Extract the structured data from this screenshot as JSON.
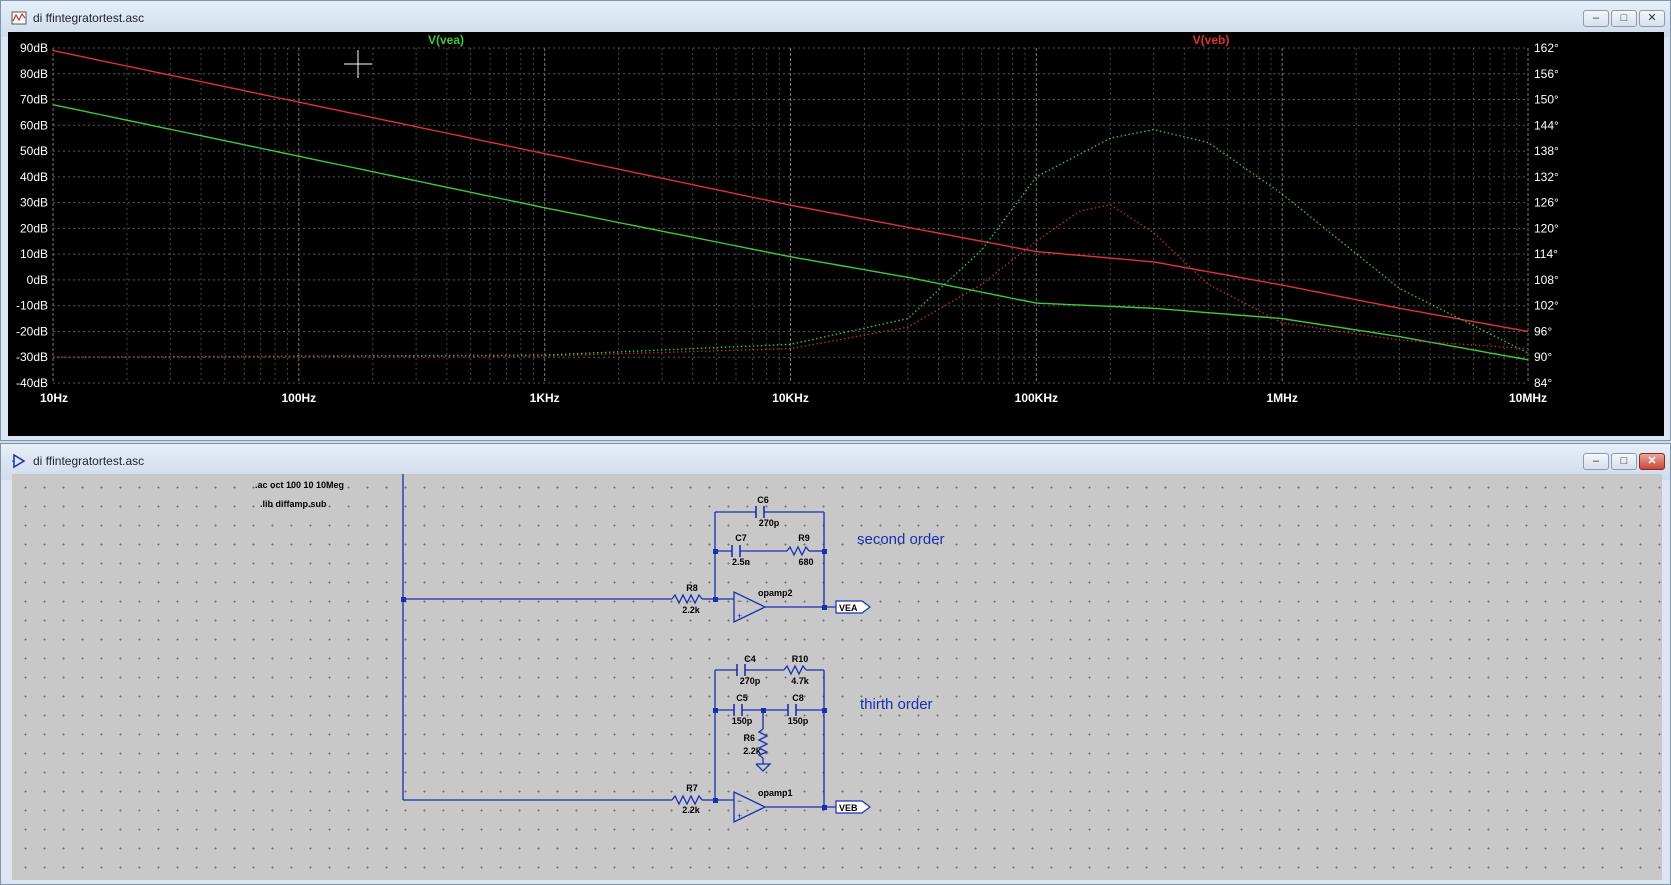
{
  "plot_window": {
    "title": "di ffintegratortest.asc",
    "controls": {
      "minimize": "–",
      "restore": "□",
      "close": "✕"
    }
  },
  "schematic_window": {
    "title": "di ffintegratortest.asc",
    "controls": {
      "minimize": "–",
      "restore": "□",
      "close": "✕"
    }
  },
  "chart_data": {
    "type": "line",
    "x_scale": "log",
    "xlim": [
      10,
      10000000
    ],
    "x_ticks": [
      {
        "value": 10,
        "label": "10Hz"
      },
      {
        "value": 100,
        "label": "100Hz"
      },
      {
        "value": 1000,
        "label": "1KHz"
      },
      {
        "value": 10000,
        "label": "10KHz"
      },
      {
        "value": 100000,
        "label": "100KHz"
      },
      {
        "value": 1000000,
        "label": "1MHz"
      },
      {
        "value": 10000000,
        "label": "10MHz"
      }
    ],
    "ylim": [
      -40,
      90
    ],
    "y_ticks": [
      "90dB",
      "80dB",
      "70dB",
      "60dB",
      "50dB",
      "40dB",
      "30dB",
      "20dB",
      "10dB",
      "0dB",
      "-10dB",
      "-20dB",
      "-30dB",
      "-40dB"
    ],
    "y2lim": [
      84,
      162
    ],
    "y2_ticks": [
      "162°",
      "156°",
      "150°",
      "144°",
      "138°",
      "132°",
      "126°",
      "120°",
      "114°",
      "108°",
      "102°",
      "96°",
      "90°",
      "84°"
    ],
    "grid": true,
    "legend": "top",
    "series": [
      {
        "name": "V(vea)",
        "color": "#3ec93e",
        "quantity": "magnitude",
        "points": [
          [
            10,
            68
          ],
          [
            100,
            48
          ],
          [
            1000,
            28
          ],
          [
            10000,
            9
          ],
          [
            30000,
            1
          ],
          [
            100000,
            -9
          ],
          [
            300000,
            -11
          ],
          [
            1000000,
            -15
          ],
          [
            3000000,
            -22
          ],
          [
            10000000,
            -31
          ]
        ]
      },
      {
        "name": "V(veb)",
        "color": "#e03232",
        "quantity": "magnitude",
        "points": [
          [
            10,
            89
          ],
          [
            100,
            69
          ],
          [
            1000,
            49
          ],
          [
            10000,
            29
          ],
          [
            100000,
            11
          ],
          [
            300000,
            7
          ],
          [
            1000000,
            -2
          ],
          [
            3000000,
            -11
          ],
          [
            10000000,
            -20
          ]
        ]
      },
      {
        "name": "V(vea)",
        "color": "#3ec93e",
        "quantity": "phase",
        "dotted": true,
        "points": [
          [
            10,
            90
          ],
          [
            1000,
            90.5
          ],
          [
            10000,
            93
          ],
          [
            30000,
            99
          ],
          [
            60000,
            115
          ],
          [
            100000,
            132
          ],
          [
            200000,
            141
          ],
          [
            300000,
            143
          ],
          [
            500000,
            140
          ],
          [
            1000000,
            128
          ],
          [
            3000000,
            106
          ],
          [
            10000000,
            91
          ]
        ]
      },
      {
        "name": "V(veb)",
        "color": "#c03030",
        "quantity": "phase",
        "dotted": true,
        "points": [
          [
            10,
            90
          ],
          [
            1000,
            90.3
          ],
          [
            10000,
            92
          ],
          [
            30000,
            97
          ],
          [
            60000,
            107
          ],
          [
            100000,
            117
          ],
          [
            150000,
            124
          ],
          [
            200000,
            125.5
          ],
          [
            300000,
            119
          ],
          [
            500000,
            107
          ],
          [
            1000000,
            98
          ],
          [
            3000000,
            94
          ],
          [
            10000000,
            92
          ]
        ]
      }
    ]
  },
  "schematic": {
    "directives": [
      ".ac oct 100 10 10Meg",
      ".lib diffamp.sub"
    ],
    "annotations": {
      "second": "second order",
      "third": "thirth order"
    },
    "components": {
      "C6": {
        "name": "C6",
        "value": "270p"
      },
      "C7": {
        "name": "C7",
        "value": "2.5n"
      },
      "R9": {
        "name": "R9",
        "value": "680"
      },
      "R8": {
        "name": "R8",
        "value": "2.2k"
      },
      "opamp2": {
        "name": "opamp2"
      },
      "C4": {
        "name": "C4",
        "value": "270p"
      },
      "R10": {
        "name": "R10",
        "value": "4.7k"
      },
      "C5": {
        "name": "C5",
        "value": "150p"
      },
      "C8": {
        "name": "C8",
        "value": "150p"
      },
      "R6": {
        "name": "R6",
        "value": "2.2k"
      },
      "R7": {
        "name": "R7",
        "value": "2.2k"
      },
      "opamp1": {
        "name": "opamp1"
      }
    },
    "net_labels": {
      "vea": "VEA",
      "veb": "VEB"
    }
  },
  "colors": {
    "wire": "#1a2fb0",
    "text": "#000000",
    "annotation": "#1a2fb0",
    "plot_bg": "#000000",
    "grid": "#5a5a5a"
  }
}
